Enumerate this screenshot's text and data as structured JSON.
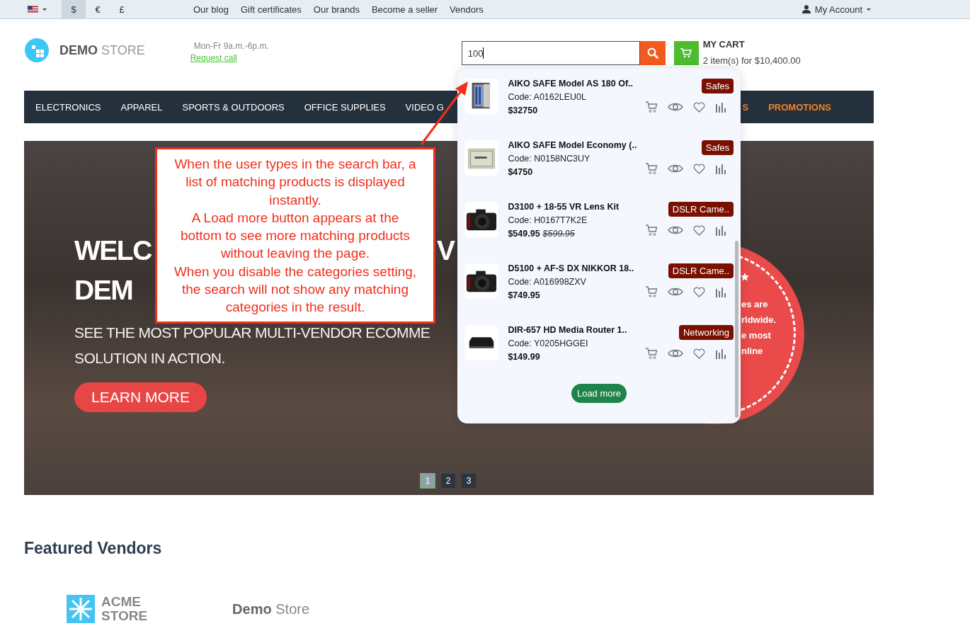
{
  "topbar": {
    "currencies": [
      {
        "label": "$",
        "selected": true
      },
      {
        "label": "€",
        "selected": false
      },
      {
        "label": "£",
        "selected": false
      }
    ],
    "links": [
      "Our blog",
      "Gift certificates",
      "Our brands",
      "Become a seller",
      "Vendors"
    ],
    "account": "My Account"
  },
  "header": {
    "logo": {
      "bold": "DEMO",
      "light": "STORE"
    },
    "hours": "Mon-Fr 9a.m.-6p.m.",
    "request_call": "Request call",
    "search": {
      "value": "100"
    },
    "cart": {
      "title": "MY CART",
      "summary": "2 item(s) for $10,400.00"
    }
  },
  "nav": {
    "left": [
      {
        "label": "ELECTRONICS",
        "highlighted": false
      },
      {
        "label": "APPAREL",
        "highlighted": false
      },
      {
        "label": "SPORTS & OUTDOORS",
        "highlighted": false
      },
      {
        "label": "OFFICE SUPPLIES",
        "highlighted": false
      },
      {
        "label": "VIDEO G",
        "highlighted": false
      }
    ],
    "right": [
      {
        "label": "S",
        "highlighted": true
      },
      {
        "label": "PROMOTIONS",
        "highlighted": true
      }
    ]
  },
  "hero": {
    "title_line1": "WELC",
    "title_line1_end": "V",
    "title_line2": "DEM",
    "subtitle_line1": "SEE THE MOST POPULAR MULTI-VENDOR ECOMME",
    "subtitle_line2": "SOLUTION IN ACTION.",
    "button": "LEARN MORE",
    "badge_lines": [
      "es are",
      "rldwide.",
      "e most",
      "nline"
    ],
    "slides": [
      {
        "label": "1",
        "selected": true
      },
      {
        "label": "2",
        "selected": false
      },
      {
        "label": "3",
        "selected": false
      }
    ]
  },
  "search_results": {
    "items": [
      {
        "kind": "safe",
        "name": "AIKO SAFE Model AS 180 Of..",
        "code": "Code: A0162LEU0L",
        "price": "$32750",
        "category": "Safes"
      },
      {
        "kind": "safe-small",
        "name": "AIKO SAFE Model Economy (..",
        "code": "Code: N0158NC3UY",
        "price": "$4750",
        "category": "Safes"
      },
      {
        "kind": "camera",
        "name": "D3100 + 18-55 VR Lens Kit",
        "code": "Code: H0167T7K2E",
        "price": "$549.95",
        "old_price": "$599.95",
        "category": "DSLR Came.."
      },
      {
        "kind": "camera",
        "name": "D5100 + AF-S DX NIKKOR 18..",
        "code": "Code: A016998ZXV",
        "price": "$749.95",
        "category": "DSLR Came.."
      },
      {
        "kind": "router",
        "name": "DIR-657 HD Media Router 1..",
        "code": "Code: Y0205HGGEI",
        "price": "$149.99",
        "category": "Networking"
      }
    ],
    "load_more": "Load more"
  },
  "callout": {
    "paragraphs": [
      "When the user types in the search bar, a list of matching products is displayed instantly.",
      "A Load more button appears at the bottom to see more matching products without leaving the page.",
      "When you disable the categories setting, the search will not show any matching categories in the result."
    ]
  },
  "featured": {
    "title": "Featured Vendors",
    "vendors": [
      {
        "kind": "acme",
        "line1": "ACME",
        "line2": "STORE"
      },
      {
        "kind": "wordmark",
        "line1": "Demo",
        "line2": "Store"
      }
    ]
  }
}
